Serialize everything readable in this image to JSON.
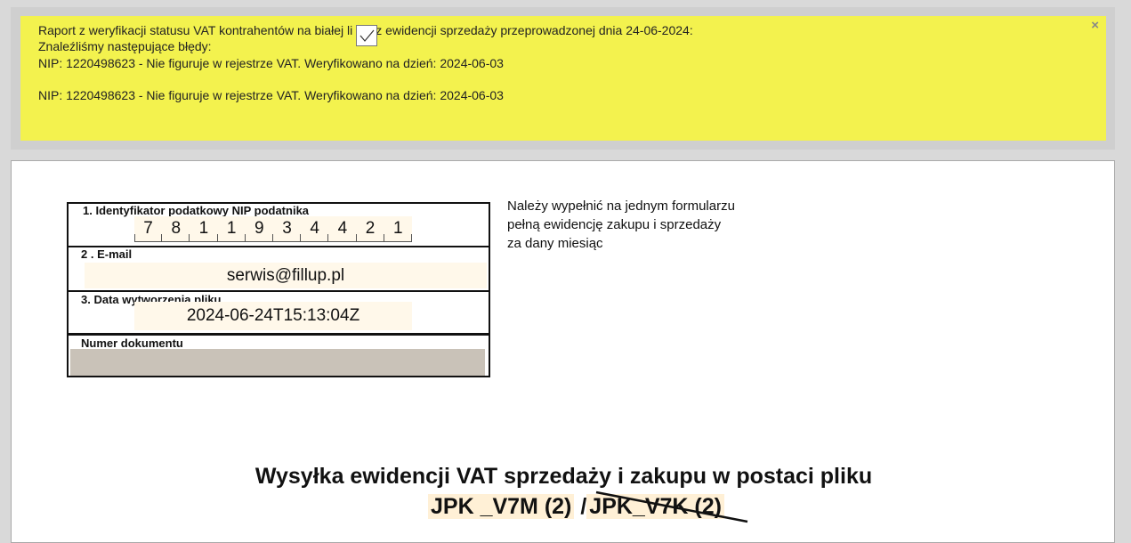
{
  "notice": {
    "line1_before": "Raport z weryfikacji statusu VAT kontrahentów na białej li",
    "line1_after": "z ewidencji sprzedaży przeprowadzonej dnia 24-06-2024:",
    "line2": "Znaleźliśmy następujące błędy:",
    "errors": [
      "NIP: 1220498623 - Nie figuruje w rejestrze VAT. Weryfikowano na dzień: 2024-06-03",
      "NIP: 1220498623 - Nie figuruje w rejestrze VAT. Weryfikowano na dzień: 2024-06-03"
    ],
    "close_symbol": "×",
    "background": "#f3f24e"
  },
  "form": {
    "nip_label": "1. Identyfikator podatkowy NIP podatnika",
    "nip_digits": [
      "7",
      "8",
      "1",
      "1",
      "9",
      "3",
      "4",
      "4",
      "2",
      "1"
    ],
    "email_label": "2 . E-mail",
    "email_value": "serwis@fillup.pl",
    "date_label": "3. Data wytworzenia pliku",
    "date_value": "2024-06-24T15:13:04Z",
    "docnum_label": "Numer dokumentu",
    "side_note": [
      "Należy wypełnić na jednym formularzu",
      "pełną ewidencję zakupu i sprzedaży",
      "za dany miesiąc"
    ],
    "heading": "Wysyłka ewidencji VAT sprzedaży i zakupu w postaci pliku",
    "jpk_v7m": "JPK _V7M (2)",
    "separator": " /",
    "jpk_v7k": "JPK_V7K (2)"
  },
  "icons": {
    "checkbox": "check-icon",
    "close": "close-icon"
  }
}
